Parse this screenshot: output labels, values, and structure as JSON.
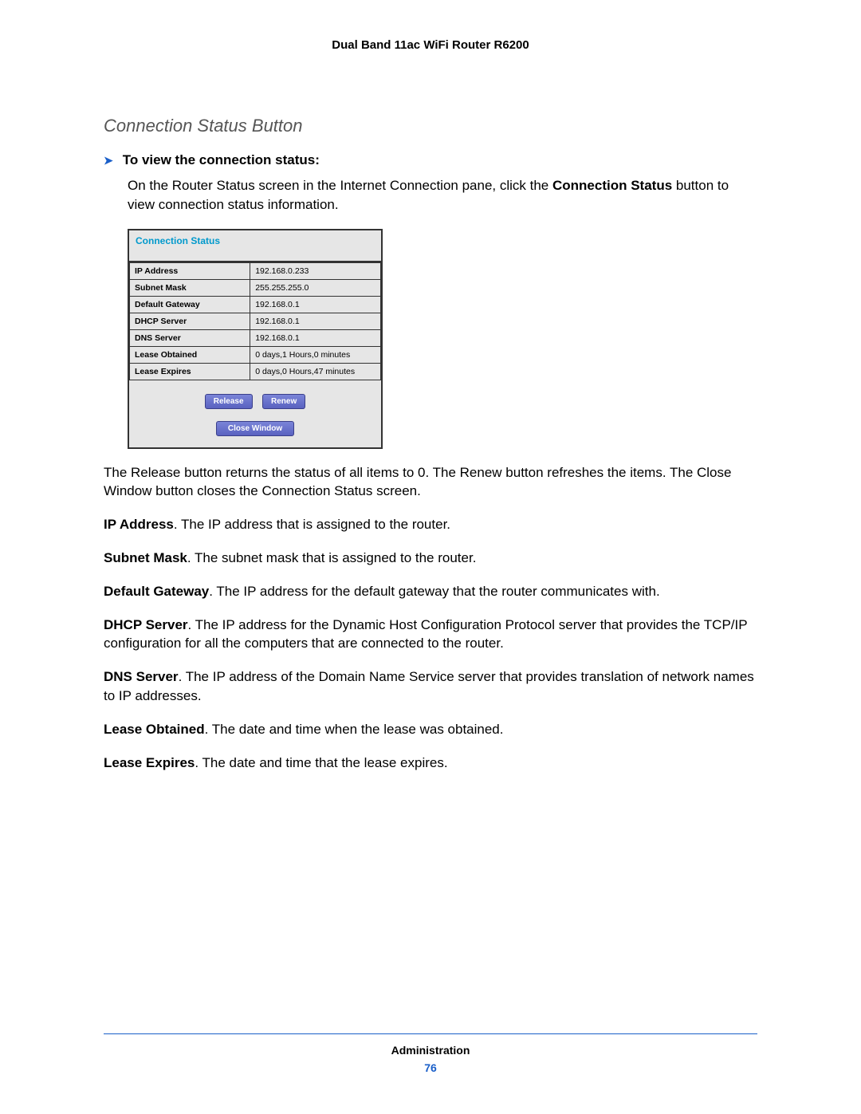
{
  "header": {
    "title": "Dual Band 11ac WiFi Router R6200"
  },
  "section": {
    "heading": "Connection Status Button",
    "step_label": "To view the connection status:",
    "intro_prefix": "On the Router Status screen in the Internet Connection pane, click the ",
    "intro_bold": "Connection Status",
    "intro_suffix": " button to view connection status information."
  },
  "screenshot": {
    "title": "Connection Status",
    "rows": [
      {
        "label": "IP Address",
        "value": "192.168.0.233"
      },
      {
        "label": "Subnet Mask",
        "value": "255.255.255.0"
      },
      {
        "label": "Default Gateway",
        "value": "192.168.0.1"
      },
      {
        "label": "DHCP Server",
        "value": "192.168.0.1"
      },
      {
        "label": "DNS Server",
        "value": "192.168.0.1"
      },
      {
        "label": "Lease Obtained",
        "value": "0 days,1 Hours,0 minutes"
      },
      {
        "label": "Lease Expires",
        "value": "0 days,0 Hours,47 minutes"
      }
    ],
    "buttons": {
      "release": "Release",
      "renew": "Renew",
      "close": "Close Window"
    }
  },
  "paragraphs": {
    "after_screenshot": "The Release button returns the status of all items to 0. The Renew button refreshes the items. The Close Window button closes the Connection Status screen.",
    "defs": [
      {
        "term": "IP Address",
        "desc": ". The IP address that is assigned to the router."
      },
      {
        "term": "Subnet Mask",
        "desc": ". The subnet mask that is assigned to the router."
      },
      {
        "term": "Default Gateway",
        "desc": ". The IP address for the default gateway that the router communicates with."
      },
      {
        "term": "DHCP Server",
        "desc": ". The IP address for the Dynamic Host Configuration Protocol server that provides the TCP/IP configuration for all the computers that are connected to the router."
      },
      {
        "term": "DNS Server",
        "desc": ". The IP address of the Domain Name Service server that provides translation of network names to IP addresses."
      },
      {
        "term": "Lease Obtained",
        "desc": ". The date and time when the lease was obtained."
      },
      {
        "term": "Lease Expires",
        "desc": ". The date and time that the lease expires."
      }
    ]
  },
  "footer": {
    "section": "Administration",
    "page": "76"
  }
}
